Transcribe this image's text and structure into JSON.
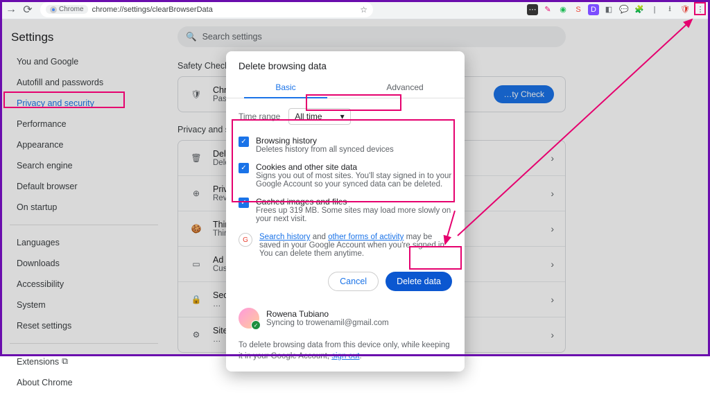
{
  "browser": {
    "chrome_label": "Chrome",
    "url": "chrome://settings/clearBrowserData"
  },
  "settings_title": "Settings",
  "search_placeholder": "Search settings",
  "sidebar": {
    "items": [
      "You and Google",
      "Autofill and passwords",
      "Privacy and security",
      "Performance",
      "Appearance",
      "Search engine",
      "Default browser",
      "On startup"
    ],
    "items2": [
      "Languages",
      "Downloads",
      "Accessibility",
      "System",
      "Reset settings"
    ],
    "extensions": "Extensions",
    "about": "About Chrome"
  },
  "main": {
    "safety_check_label": "Safety Check",
    "safety_card_title": "Chrome …",
    "safety_card_sub": "Passe…",
    "safety_button": "…ty Check",
    "privacy_label": "Privacy and s…",
    "rows": [
      {
        "t": "Del…",
        "s": "Dele…"
      },
      {
        "t": "Priva…",
        "s": "Revie…"
      },
      {
        "t": "Third…",
        "s": "Third…"
      },
      {
        "t": "Ad p…",
        "s": "Cust…"
      },
      {
        "t": "Secu…",
        "s": "…"
      },
      {
        "t": "Site p…",
        "s": "…"
      }
    ]
  },
  "dialog": {
    "title": "Delete browsing data",
    "tabs": {
      "basic": "Basic",
      "advanced": "Advanced"
    },
    "time_range_label": "Time range",
    "time_range_value": "All time",
    "options": [
      {
        "t": "Browsing history",
        "d": "Deletes history from all synced devices"
      },
      {
        "t": "Cookies and other site data",
        "d": "Signs you out of most sites. You'll stay signed in to your Google Account so your synced data can be deleted."
      },
      {
        "t": "Cached images and files",
        "d": "Frees up 319 MB. Some sites may load more slowly on your next visit."
      }
    ],
    "info_pre": "",
    "info_link1": "Search history",
    "info_mid": " and ",
    "info_link2": "other forms of activity",
    "info_post": " may be saved in your Google Account when you're signed in. You can delete them anytime.",
    "cancel": "Cancel",
    "delete": "Delete data",
    "user_name": "Rowena Tubiano",
    "user_sync": "Syncing to trowenamil@gmail.com",
    "note_pre": "To delete browsing data from this device only, while keeping it in your Google Account, ",
    "note_link": "sign out",
    "note_post": "."
  }
}
